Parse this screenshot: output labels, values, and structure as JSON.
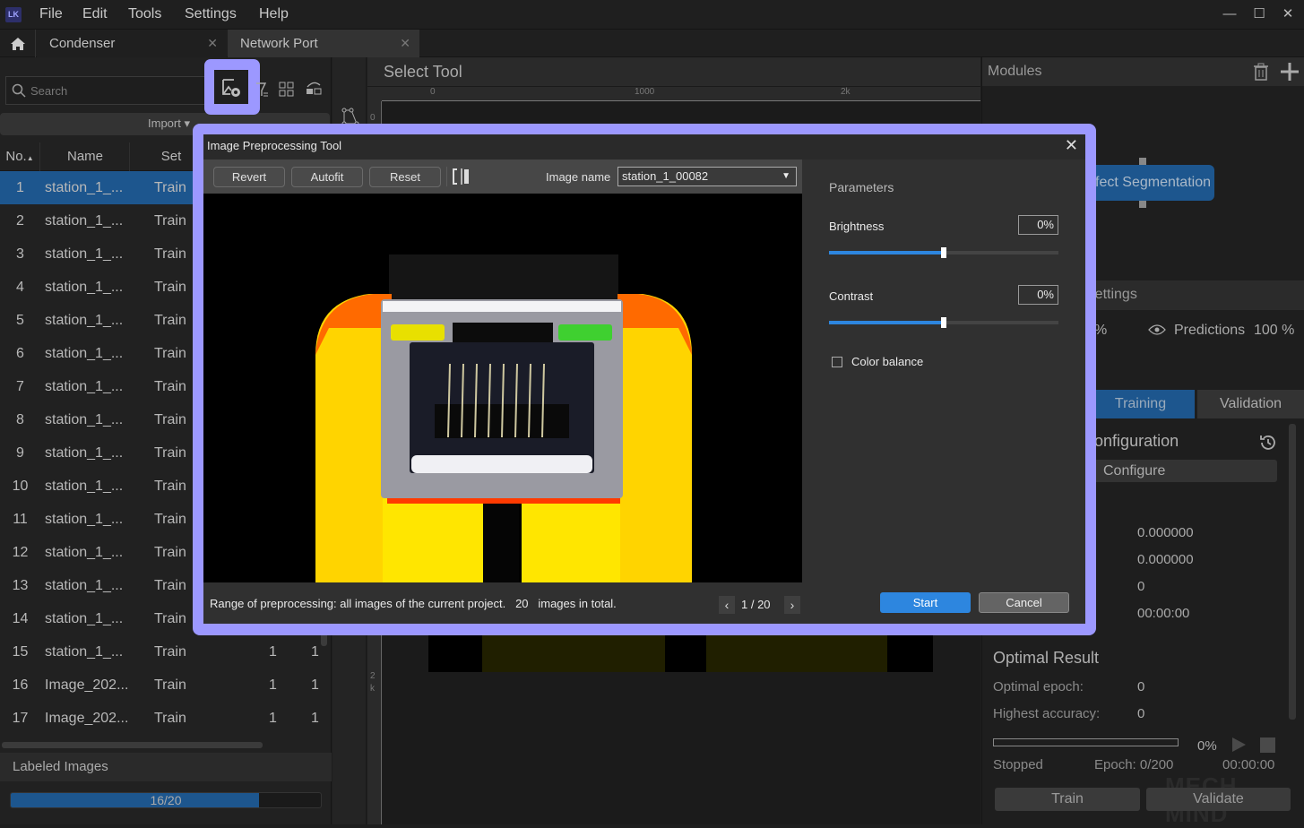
{
  "app": {
    "logo_text": "LK",
    "menu": [
      "File",
      "Edit",
      "Tools",
      "Settings",
      "Help"
    ]
  },
  "tabs": [
    {
      "label": "Condenser",
      "active": false
    },
    {
      "label": "Network Port",
      "active": true
    }
  ],
  "sidebar": {
    "search_placeholder": "Search",
    "import_label": "Import ▾",
    "columns": [
      "No.",
      "Name",
      "Set"
    ],
    "rows": [
      {
        "no": "1",
        "name": "station_1_...",
        "set": "Train",
        "a": "",
        "b": "",
        "selected": true
      },
      {
        "no": "2",
        "name": "station_1_...",
        "set": "Train",
        "a": "",
        "b": ""
      },
      {
        "no": "3",
        "name": "station_1_...",
        "set": "Train",
        "a": "",
        "b": ""
      },
      {
        "no": "4",
        "name": "station_1_...",
        "set": "Train",
        "a": "",
        "b": ""
      },
      {
        "no": "5",
        "name": "station_1_...",
        "set": "Train",
        "a": "",
        "b": ""
      },
      {
        "no": "6",
        "name": "station_1_...",
        "set": "Train",
        "a": "",
        "b": ""
      },
      {
        "no": "7",
        "name": "station_1_...",
        "set": "Train",
        "a": "",
        "b": ""
      },
      {
        "no": "8",
        "name": "station_1_...",
        "set": "Train",
        "a": "",
        "b": ""
      },
      {
        "no": "9",
        "name": "station_1_...",
        "set": "Train",
        "a": "",
        "b": ""
      },
      {
        "no": "10",
        "name": "station_1_...",
        "set": "Train",
        "a": "",
        "b": ""
      },
      {
        "no": "11",
        "name": "station_1_...",
        "set": "Train",
        "a": "",
        "b": ""
      },
      {
        "no": "12",
        "name": "station_1_...",
        "set": "Train",
        "a": "",
        "b": ""
      },
      {
        "no": "13",
        "name": "station_1_...",
        "set": "Train",
        "a": "",
        "b": ""
      },
      {
        "no": "14",
        "name": "station_1_...",
        "set": "Train",
        "a": "",
        "b": ""
      },
      {
        "no": "15",
        "name": "station_1_...",
        "set": "Train",
        "a": "1",
        "b": "1"
      },
      {
        "no": "16",
        "name": "Image_202...",
        "set": "Train",
        "a": "1",
        "b": "1"
      },
      {
        "no": "17",
        "name": "Image_202...",
        "set": "Train",
        "a": "1",
        "b": "1"
      }
    ],
    "labeled_title": "Labeled Images",
    "labeled_text": "16/20",
    "labeled_fraction": 0.8
  },
  "canvas": {
    "title": "Select Tool",
    "ruler_x": [
      "0",
      "1000",
      "2k"
    ],
    "ruler_y": [
      "0",
      "2k"
    ]
  },
  "right": {
    "modules_title": "Modules",
    "module_node": "Defect Segmentation",
    "settings_title": "Settings",
    "pred_partial": "%",
    "predictions_label": "Predictions",
    "predictions_value": "100 %",
    "tabs": [
      "Training",
      "Validation"
    ],
    "param_config": "Parameter Configuration",
    "configure_label": "Configure",
    "stats": [
      "0.000000",
      "0.000000",
      "0",
      "00:00:00"
    ],
    "optimal_title": "Optimal Result",
    "optimal_epoch_label": "Optimal epoch:",
    "optimal_epoch_value": "0",
    "highest_acc_label": "Highest accuracy:",
    "highest_acc_value": "0",
    "progress_pct": "0%",
    "progress_fraction": 0,
    "status": "Stopped",
    "epoch": "Epoch: 0/200",
    "elapsed": "00:00:00",
    "train_label": "Train",
    "validate_label": "Validate",
    "watermark": "MECH MIND"
  },
  "dialog": {
    "title": "Image Preprocessing Tool",
    "buttons": {
      "revert": "Revert",
      "autofit": "Autofit",
      "reset": "Reset"
    },
    "image_name_label": "Image name",
    "image_name_value": "station_1_00082",
    "params_title": "Parameters",
    "brightness_label": "Brightness",
    "brightness_value": "0%",
    "brightness_fraction": 0.5,
    "contrast_label": "Contrast",
    "contrast_value": "0%",
    "contrast_fraction": 0.5,
    "color_balance_label": "Color balance",
    "color_balance_checked": false,
    "range_text": "Range of preprocessing: all images of the current project.   20   images in total.",
    "pager": "1  /  20",
    "start_label": "Start",
    "cancel_label": "Cancel"
  }
}
